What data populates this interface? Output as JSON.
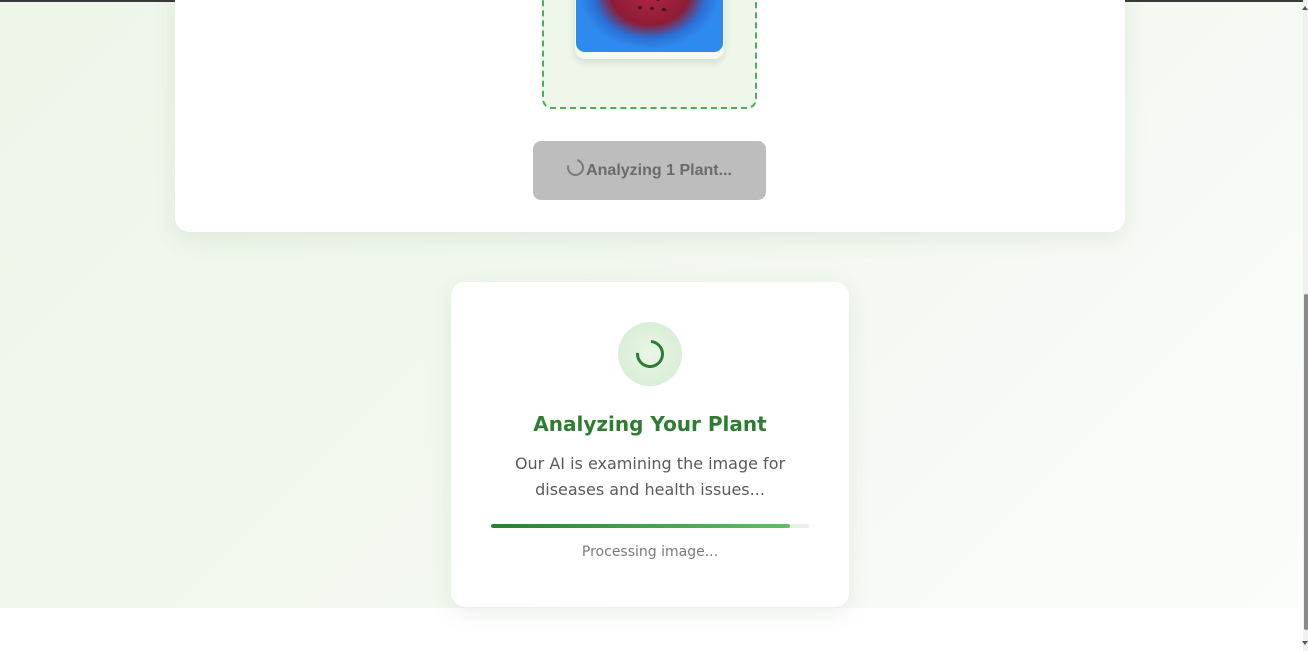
{
  "upload": {
    "analyze_button_label": "Analyzing 1 Plant..."
  },
  "loading": {
    "title": "Analyzing Your Plant",
    "description": "Our AI is examining the image for diseases and health issues...",
    "status": "Processing image...",
    "progress_fraction": 0.94
  },
  "colors": {
    "accent": "#2e7d32",
    "accent_light": "#66bb6a",
    "button_disabled": "#bdbdbd"
  }
}
